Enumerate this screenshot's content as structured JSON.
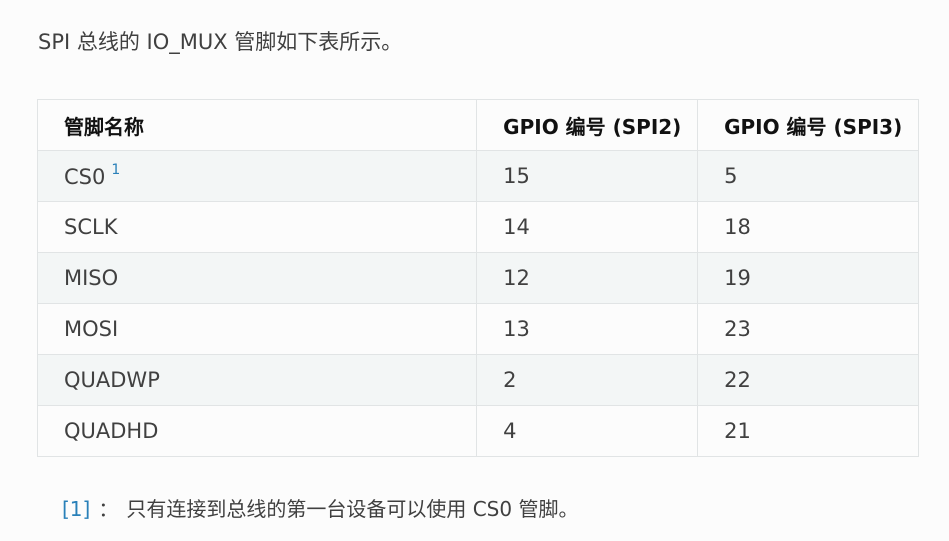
{
  "intro_text": "SPI 总线的 IO_MUX 管脚如下表所示。",
  "table": {
    "headers": [
      "管脚名称",
      "GPIO 编号 (SPI2)",
      "GPIO 编号 (SPI3)"
    ],
    "rows": [
      {
        "pin": "CS0",
        "sup": "1",
        "spi2": "15",
        "spi3": "5"
      },
      {
        "pin": "SCLK",
        "sup": "",
        "spi2": "14",
        "spi3": "18"
      },
      {
        "pin": "MISO",
        "sup": "",
        "spi2": "12",
        "spi3": "19"
      },
      {
        "pin": "MOSI",
        "sup": "",
        "spi2": "13",
        "spi3": "23"
      },
      {
        "pin": "QUADWP",
        "sup": "",
        "spi2": "2",
        "spi3": "22"
      },
      {
        "pin": "QUADHD",
        "sup": "",
        "spi2": "4",
        "spi3": "21"
      }
    ]
  },
  "footnote": {
    "ref": "[1]",
    "separator": "：",
    "text": "只有连接到总线的第一台设备可以使用 CS0 管脚。"
  },
  "colors": {
    "link": "#2980b9",
    "text": "#404040",
    "row_alt": "#f3f6f6",
    "border": "#e1e4e5"
  }
}
